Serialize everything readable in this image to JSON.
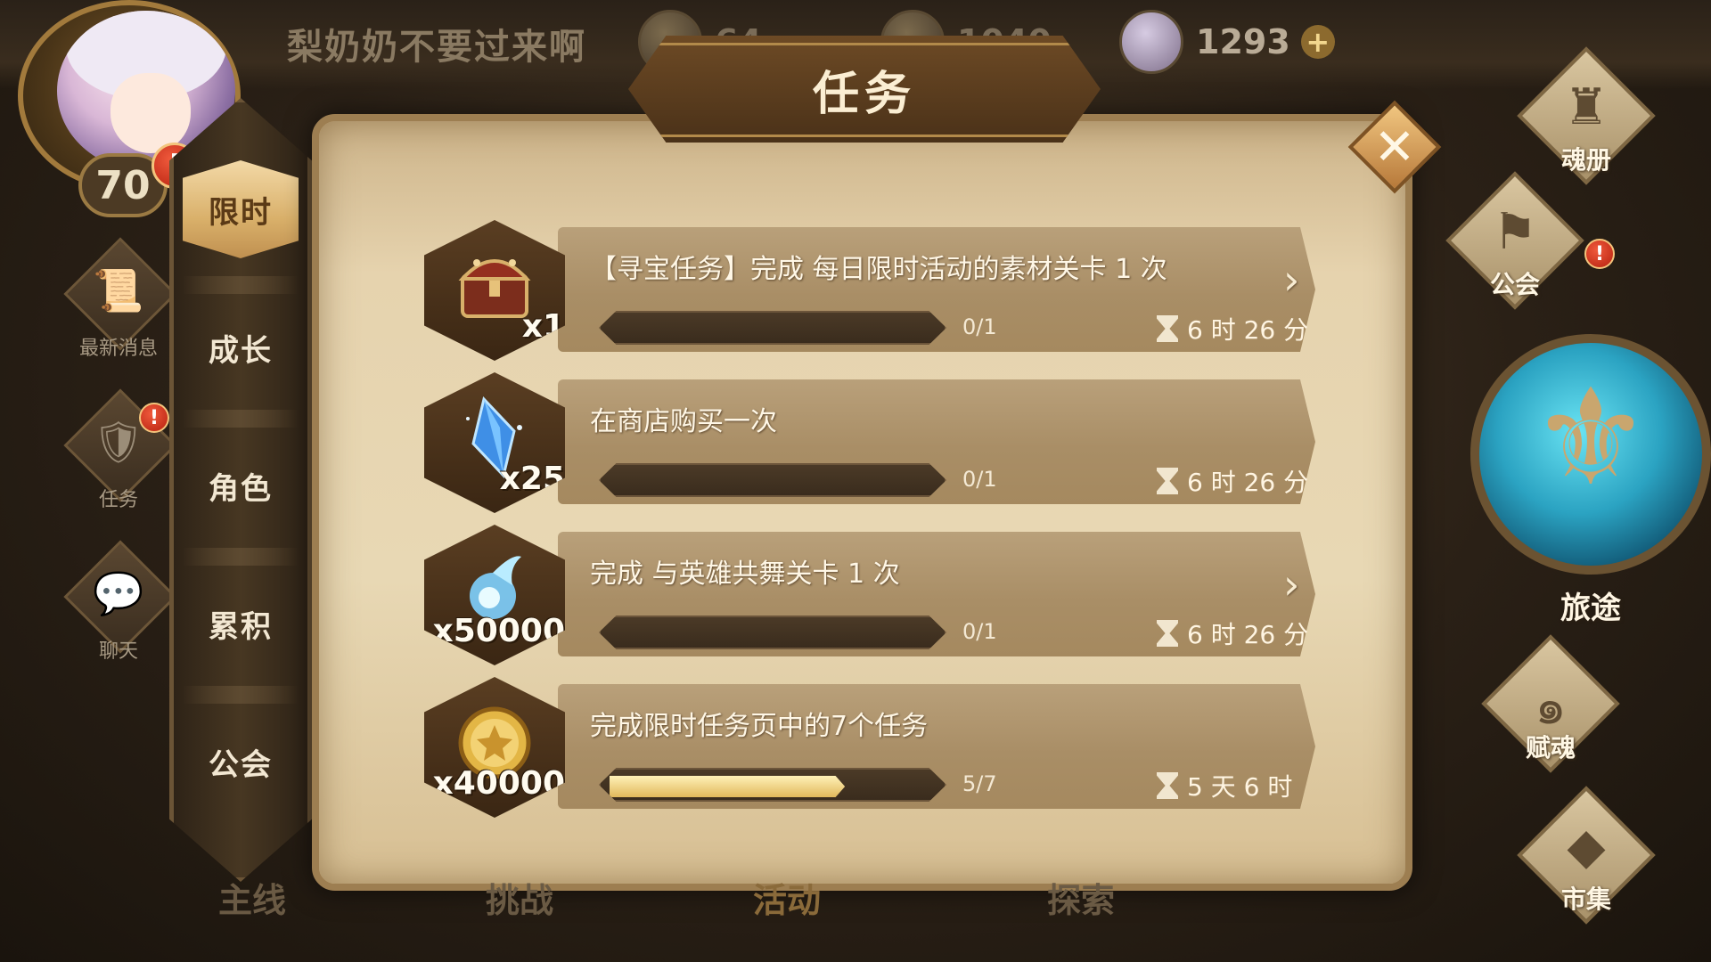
{
  "player": {
    "name": "梨奶奶不要过来啊",
    "level": "70",
    "alert": "!"
  },
  "resources": {
    "gold": {
      "value": "64",
      "icon": "gold-coin-icon"
    },
    "crystal": {
      "value": "1040",
      "icon": "blue-crystal-icon"
    },
    "gem": {
      "value": "1293",
      "icon": "gem-icon",
      "plus": "+"
    }
  },
  "title": "任务",
  "left_sidebar": [
    {
      "label": "最新消息",
      "icon": "scroll-icon",
      "glyph": "📜",
      "alert": false
    },
    {
      "label": "任务",
      "icon": "badge-icon",
      "glyph": "🛡",
      "alert": true
    },
    {
      "label": "聊天",
      "icon": "chat-icon",
      "glyph": "💬",
      "alert": false
    }
  ],
  "tabs": [
    {
      "label": "限时",
      "active": true
    },
    {
      "label": "成长",
      "active": false
    },
    {
      "label": "角色",
      "active": false
    },
    {
      "label": "累积",
      "active": false
    },
    {
      "label": "公会",
      "active": false
    }
  ],
  "tasks": [
    {
      "description": "【寻宝任务】完成 每日限时活动的素材关卡 1 次",
      "reward_icon": "treasure-chest-icon",
      "reward_qty": "x1",
      "progress_text": "0/1",
      "progress_fraction": 0,
      "time_left": "6 时 26 分",
      "has_go_arrow": true
    },
    {
      "description": "在商店购买一次",
      "reward_icon": "blue-crystal-icon",
      "reward_qty": "x25",
      "progress_text": "0/1",
      "progress_fraction": 0,
      "time_left": "6 时 26 分",
      "has_go_arrow": false
    },
    {
      "description": "完成 与英雄共舞关卡 1 次",
      "reward_icon": "soul-flame-icon",
      "reward_qty": "x50000",
      "progress_text": "0/1",
      "progress_fraction": 0,
      "time_left": "6 时 26 分",
      "has_go_arrow": true
    },
    {
      "description": "完成限时任务页中的7个任务",
      "reward_icon": "gold-coin-icon",
      "reward_qty": "x40000",
      "progress_text": "5/7",
      "progress_fraction": 0.714,
      "time_left": "5 天 6 时",
      "has_go_arrow": false
    }
  ],
  "right_sidebar": {
    "soul_book": "魂册",
    "guild": "公会",
    "journey": "旅途",
    "soul_infuse": "赋魂",
    "market": "市集"
  },
  "bottom_nav": [
    "主线",
    "挑战",
    "活动",
    "探索"
  ],
  "colors": {
    "accent_gold": "#e1b85b",
    "alert_red": "#b6200f",
    "panel_parchment": "#e6d3ae",
    "journey_orb": "#2ba3c2"
  }
}
